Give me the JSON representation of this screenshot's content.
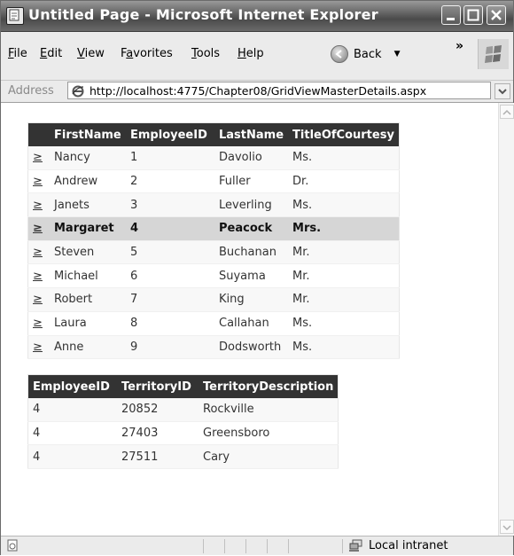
{
  "window": {
    "title": "Untitled Page - Microsoft Internet Explorer"
  },
  "menu": {
    "items": [
      {
        "pre": "",
        "u": "F",
        "post": "ile"
      },
      {
        "pre": "",
        "u": "E",
        "post": "dit"
      },
      {
        "pre": "",
        "u": "V",
        "post": "iew"
      },
      {
        "pre": "F",
        "u": "a",
        "post": "vorites"
      },
      {
        "pre": "",
        "u": "T",
        "post": "ools"
      },
      {
        "pre": "",
        "u": "H",
        "post": "elp"
      }
    ],
    "back_label": "Back",
    "chevrons": "»"
  },
  "address": {
    "label": "Address",
    "url": "http://localhost:4775/Chapter08/GridViewMasterDetails.aspx"
  },
  "master": {
    "select_label": "≥",
    "headers": [
      "FirstName",
      "EmployeeID",
      "LastName",
      "TitleOfCourtesy"
    ],
    "selected_index": 3,
    "rows": [
      [
        "Nancy",
        "1",
        "Davolio",
        "Ms."
      ],
      [
        "Andrew",
        "2",
        "Fuller",
        "Dr."
      ],
      [
        "Janets",
        "3",
        "Leverling",
        "Ms."
      ],
      [
        "Margaret",
        "4",
        "Peacock",
        "Mrs."
      ],
      [
        "Steven",
        "5",
        "Buchanan",
        "Mr."
      ],
      [
        "Michael",
        "6",
        "Suyama",
        "Mr."
      ],
      [
        "Robert",
        "7",
        "King",
        "Mr."
      ],
      [
        "Laura",
        "8",
        "Callahan",
        "Ms."
      ],
      [
        "Anne",
        "9",
        "Dodsworth",
        "Ms."
      ]
    ]
  },
  "detail": {
    "headers": [
      "EmployeeID",
      "TerritoryID",
      "TerritoryDescription"
    ],
    "rows": [
      [
        "4",
        "20852",
        "Rockville"
      ],
      [
        "4",
        "27403",
        "Greensboro"
      ],
      [
        "4",
        "27511",
        "Cary"
      ]
    ]
  },
  "status": {
    "zone": "Local intranet"
  },
  "colors": {
    "header_bg": "#333333",
    "selected_row_bg": "#d6d6d6",
    "alt_row_bg": "#f8f8f8"
  }
}
